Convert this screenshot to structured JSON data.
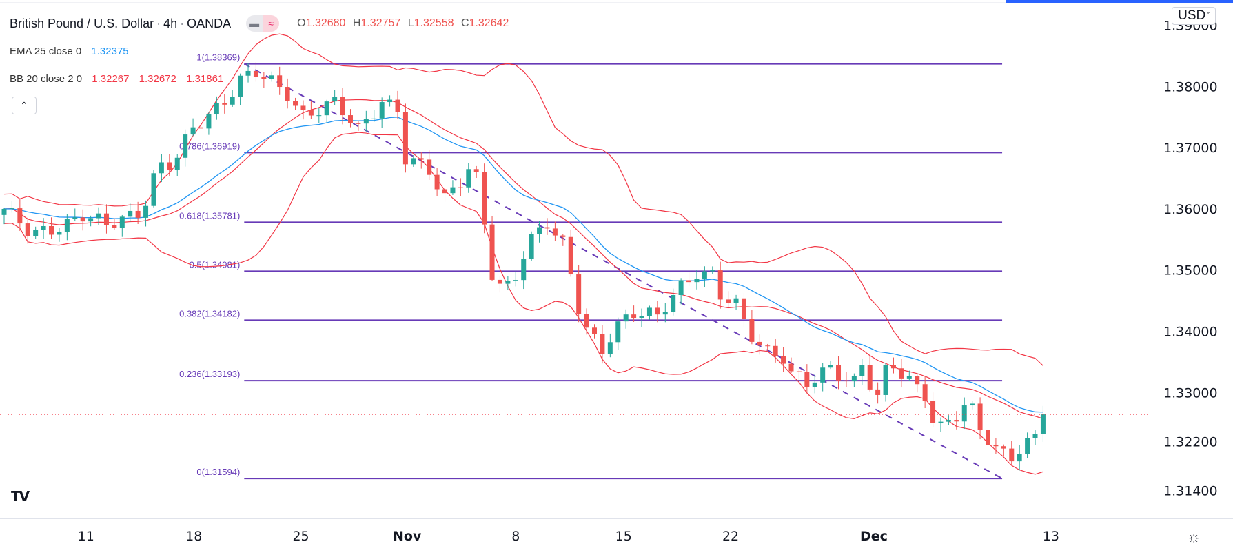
{
  "header": {
    "symbol": "British Pound / U.S. Dollar",
    "interval": "4h",
    "exchange": "OANDA",
    "ohlc": {
      "o_label": "O",
      "o": "1.32680",
      "h_label": "H",
      "h": "1.32757",
      "l_label": "L",
      "l": "1.32558",
      "c_label": "C",
      "c": "1.32642"
    },
    "toggle_icons": [
      "minus-icon",
      "wave-icon"
    ]
  },
  "indicators": {
    "ema": {
      "label": "EMA 25 close 0",
      "value": "1.32375"
    },
    "bb": {
      "label": "BB 20 close 2 0",
      "basis": "1.32267",
      "upper": "1.32672",
      "lower": "1.31861"
    }
  },
  "currency_button": "USD",
  "colors": {
    "up": "#26a69a",
    "down": "#ef5350",
    "ema": "#2196f3",
    "bb": "#f23645",
    "fib": "#673ab7",
    "price_line": "#f23645"
  },
  "chart_data": {
    "type": "candlestick",
    "title": "British Pound / U.S. Dollar · 4h · OANDA",
    "ylim": [
      1.3105,
      1.3935
    ],
    "y_ticks": [
      "1.39000",
      "1.38000",
      "1.37000",
      "1.36000",
      "1.35000",
      "1.34000",
      "1.33000",
      "1.32200",
      "1.31400"
    ],
    "y_tick_values": [
      1.39,
      1.38,
      1.37,
      1.36,
      1.35,
      1.34,
      1.33,
      1.322,
      1.314
    ],
    "x_ticks": [
      {
        "label": "11",
        "index": 10.4
      },
      {
        "label": "18",
        "index": 24.1
      },
      {
        "label": "25",
        "index": 37.7
      },
      {
        "label": "Nov",
        "index": 51.2
      },
      {
        "label": "8",
        "index": 65.0
      },
      {
        "label": "15",
        "index": 78.7
      },
      {
        "label": "22",
        "index": 92.3
      },
      {
        "label": "Dec",
        "index": 110.5
      },
      {
        "label": "13",
        "index": 133.0
      }
    ],
    "candle_count": 133,
    "close_path": [
      [
        0,
        1.36
      ],
      [
        3.5,
        1.3555
      ],
      [
        10,
        1.359
      ],
      [
        13,
        1.357
      ],
      [
        17.5,
        1.36
      ],
      [
        19.5,
        1.367
      ],
      [
        21.5,
        1.367
      ],
      [
        24,
        1.373
      ],
      [
        28,
        1.378
      ],
      [
        30,
        1.381
      ],
      [
        32,
        1.382
      ],
      [
        36,
        1.379
      ],
      [
        38,
        1.3755
      ],
      [
        42,
        1.377
      ],
      [
        45,
        1.373
      ],
      [
        48,
        1.378
      ],
      [
        50,
        1.376
      ],
      [
        51,
        1.368
      ],
      [
        54,
        1.366
      ],
      [
        56,
        1.362
      ],
      [
        58,
        1.365
      ],
      [
        59.5,
        1.368
      ],
      [
        60.8,
        1.36
      ],
      [
        61.5,
        1.35
      ],
      [
        63.5,
        1.346
      ],
      [
        65,
        1.349
      ],
      [
        66.5,
        1.355
      ],
      [
        69,
        1.358
      ],
      [
        71,
        1.354
      ],
      [
        72.5,
        1.346
      ],
      [
        73.5,
        1.341
      ],
      [
        76,
        1.337
      ],
      [
        77.5,
        1.341
      ],
      [
        80,
        1.343
      ],
      [
        83,
        1.342
      ],
      [
        85.5,
        1.347
      ],
      [
        88,
        1.35
      ],
      [
        90,
        1.349
      ],
      [
        90.5,
        1.346
      ],
      [
        93,
        1.344
      ],
      [
        94.5,
        1.34
      ],
      [
        97,
        1.337
      ],
      [
        99,
        1.336
      ],
      [
        100,
        1.333
      ],
      [
        102,
        1.331
      ],
      [
        105,
        1.334
      ],
      [
        108,
        1.332
      ],
      [
        109.5,
        1.336
      ],
      [
        110.5,
        1.327
      ],
      [
        112,
        1.333
      ],
      [
        113,
        1.334
      ],
      [
        115,
        1.332
      ],
      [
        117,
        1.33
      ],
      [
        118.5,
        1.324
      ],
      [
        121,
        1.326
      ],
      [
        122.5,
        1.328
      ],
      [
        124,
        1.324
      ],
      [
        126,
        1.321
      ],
      [
        128,
        1.32
      ],
      [
        130,
        1.3215
      ],
      [
        131,
        1.3225
      ],
      [
        132,
        1.3264
      ]
    ],
    "last_price": 1.32642,
    "ema_period": 25,
    "bb_period": 20,
    "bb_stddev": 2,
    "fibonacci": {
      "start_index": 30.5,
      "end_index": 126.8,
      "high": 1.38369,
      "low": 1.31594,
      "levels": [
        {
          "ratio": "1",
          "price": "1.38369",
          "label": "1(1.38369)"
        },
        {
          "ratio": "0.786",
          "price": "1.36919",
          "label": "0.786(1.36919)"
        },
        {
          "ratio": "0.618",
          "price": "1.35781",
          "label": "0.618(1.35781)"
        },
        {
          "ratio": "0.5",
          "price": "1.34981",
          "label": "0.5(1.34981)"
        },
        {
          "ratio": "0.382",
          "price": "1.34182",
          "label": "0.382(1.34182)"
        },
        {
          "ratio": "0.236",
          "price": "1.33193",
          "label": "0.236(1.33193)"
        },
        {
          "ratio": "0",
          "price": "1.31594",
          "label": "0(1.31594)"
        }
      ]
    }
  }
}
